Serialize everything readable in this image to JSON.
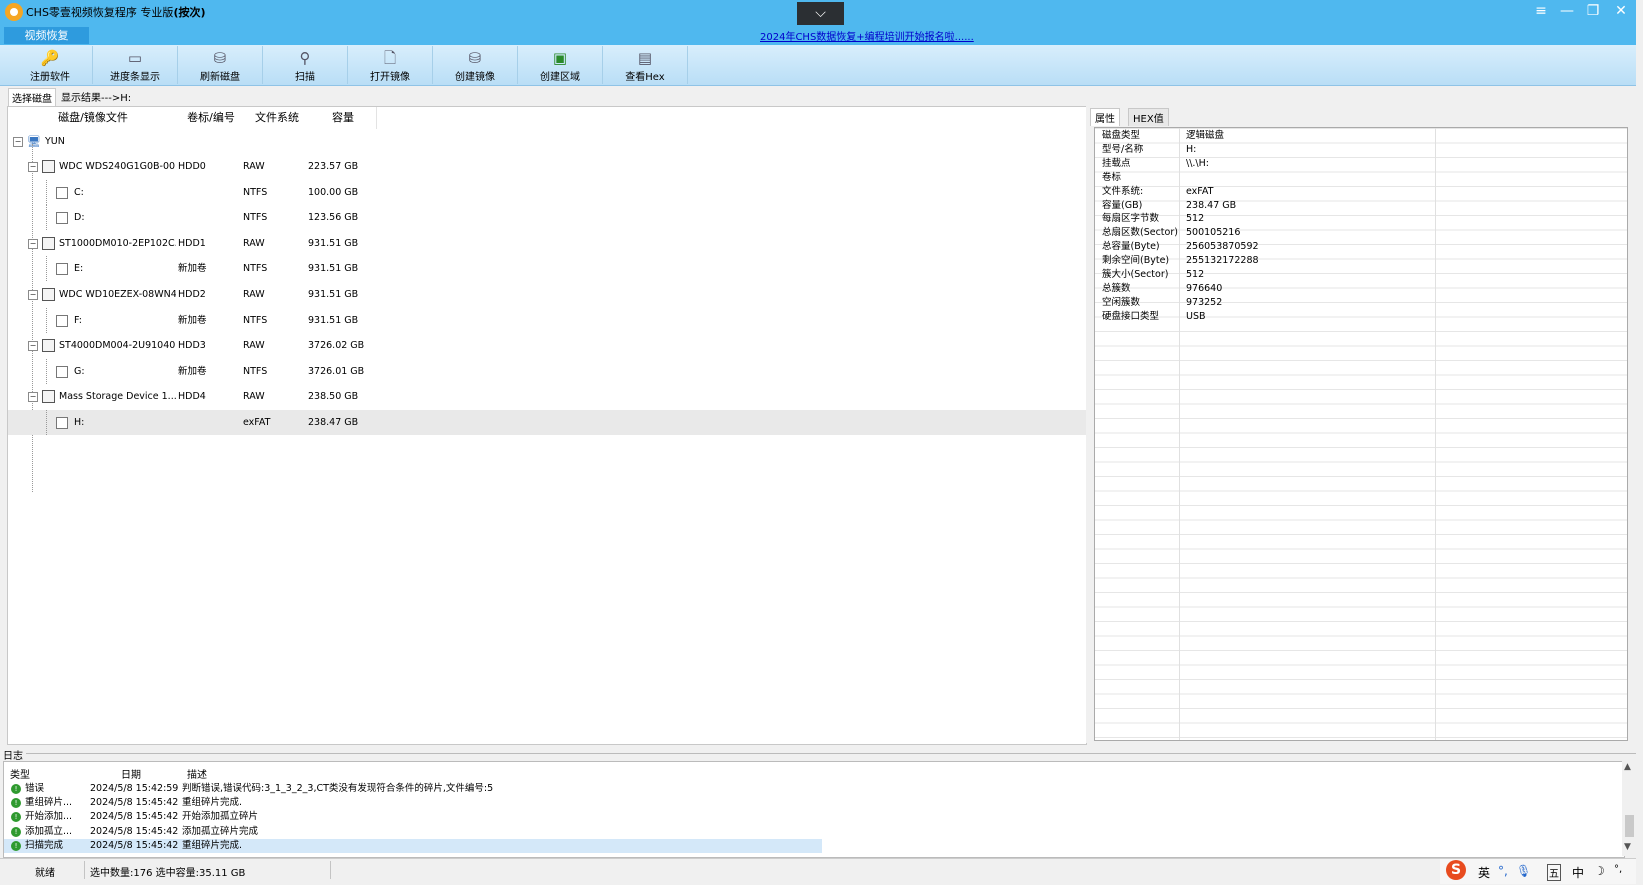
{
  "window": {
    "title": "CHS零壹视频恢复程序 专业版",
    "title_suffix": "(按次)",
    "collapse_icon": "chevron-down-icon",
    "controls": {
      "menu": "≡",
      "minimize": "—",
      "maximize": "❐",
      "close": "✕"
    }
  },
  "tabs": {
    "video_recovery": "视频恢复"
  },
  "promo": {
    "text": "2024年CHS数据恢复+编程培训开始报名啦......"
  },
  "toolbar": [
    {
      "label": "注册软件",
      "icon": "key-icon"
    },
    {
      "label": "进度条显示",
      "icon": "monitor-icon"
    },
    {
      "label": "刷新磁盘",
      "icon": "disk-refresh-icon"
    },
    {
      "label": "扫描",
      "icon": "magnifier-icon"
    },
    {
      "label": "打开镜像",
      "icon": "open-image-icon"
    },
    {
      "label": "创建镜像",
      "icon": "create-image-icon"
    },
    {
      "label": "创建区域",
      "icon": "create-region-icon"
    },
    {
      "label": "查看Hex",
      "icon": "hex-view-icon"
    }
  ],
  "subtabs": {
    "select_disk": "选择磁盘",
    "show_result": "显示结果--->H:"
  },
  "disk_table": {
    "headers": [
      "磁盘/镜像文件",
      "卷标/编号",
      "文件系统",
      "容量"
    ],
    "root": "YUN",
    "rows": [
      {
        "name": "WDC WDS240G1G0B-00...",
        "label": "HDD0",
        "fs": "RAW",
        "size": "223.57 GB",
        "level": 1
      },
      {
        "name": "C:",
        "label": "",
        "fs": "NTFS",
        "size": "100.00 GB",
        "level": 2
      },
      {
        "name": "D:",
        "label": "",
        "fs": "NTFS",
        "size": "123.56 GB",
        "level": 2
      },
      {
        "name": "ST1000DM010-2EP102C...",
        "label": "HDD1",
        "fs": "RAW",
        "size": "931.51 GB",
        "level": 1
      },
      {
        "name": "E:",
        "label": "新加卷",
        "fs": "NTFS",
        "size": "931.51 GB",
        "level": 2
      },
      {
        "name": "WDC WD10EZEX-08WN4...",
        "label": "HDD2",
        "fs": "RAW",
        "size": "931.51 GB",
        "level": 1
      },
      {
        "name": "F:",
        "label": "新加卷",
        "fs": "NTFS",
        "size": "931.51 GB",
        "level": 2
      },
      {
        "name": "ST4000DM004-2U91040...",
        "label": "HDD3",
        "fs": "RAW",
        "size": "3726.02 GB",
        "level": 1
      },
      {
        "name": "G:",
        "label": "新加卷",
        "fs": "NTFS",
        "size": "3726.01 GB",
        "level": 2
      },
      {
        "name": "Mass   Storage Device  1...",
        "label": "HDD4",
        "fs": "RAW",
        "size": "238.50 GB",
        "level": 1
      },
      {
        "name": "H:",
        "label": "",
        "fs": "exFAT",
        "size": "238.47 GB",
        "level": 2,
        "selected": true
      }
    ]
  },
  "properties": {
    "tabs": [
      "属性",
      "HEX值"
    ],
    "rows": [
      {
        "k": "磁盘类型",
        "v": "逻辑磁盘"
      },
      {
        "k": "型号/名称",
        "v": "H:"
      },
      {
        "k": "挂载点",
        "v": "\\\\.\\H:"
      },
      {
        "k": "卷标",
        "v": ""
      },
      {
        "k": "文件系统:",
        "v": "exFAT"
      },
      {
        "k": "容量(GB)",
        "v": "238.47 GB"
      },
      {
        "k": "每扇区字节数",
        "v": "512"
      },
      {
        "k": "总扇区数(Sector)",
        "v": "500105216"
      },
      {
        "k": "总容量(Byte)",
        "v": "256053870592"
      },
      {
        "k": "剩余空间(Byte)",
        "v": "255132172288"
      },
      {
        "k": "簇大小(Sector)",
        "v": "512"
      },
      {
        "k": "总簇数",
        "v": "976640"
      },
      {
        "k": "空闲簇数",
        "v": "973252"
      },
      {
        "k": "硬盘接口类型",
        "v": "USB"
      }
    ]
  },
  "log": {
    "title": "日志",
    "headers": [
      "类型",
      "日期",
      "描述"
    ],
    "rows": [
      {
        "type": "错误",
        "date": "2024/5/8 15:42:59",
        "desc": "判断错误,错误代码:3_1_3_2_3,CT类没有发现符合条件的碎片,文件编号:5"
      },
      {
        "type": "重组碎片...",
        "date": "2024/5/8 15:45:42",
        "desc": "重组碎片完成."
      },
      {
        "type": "开始添加...",
        "date": "2024/5/8 15:45:42",
        "desc": "开始添加孤立碎片"
      },
      {
        "type": "添加孤立...",
        "date": "2024/5/8 15:45:42",
        "desc": "添加孤立碎片完成"
      },
      {
        "type": "扫描完成",
        "date": "2024/5/8 15:45:42",
        "desc": "重组碎片完成.",
        "selected": true
      }
    ]
  },
  "status": {
    "ready": "就绪",
    "selection": "选中数量:176 选中容量:35.11 GB",
    "ime": [
      "英",
      "°,",
      "中",
      "☽",
      "°,"
    ]
  }
}
